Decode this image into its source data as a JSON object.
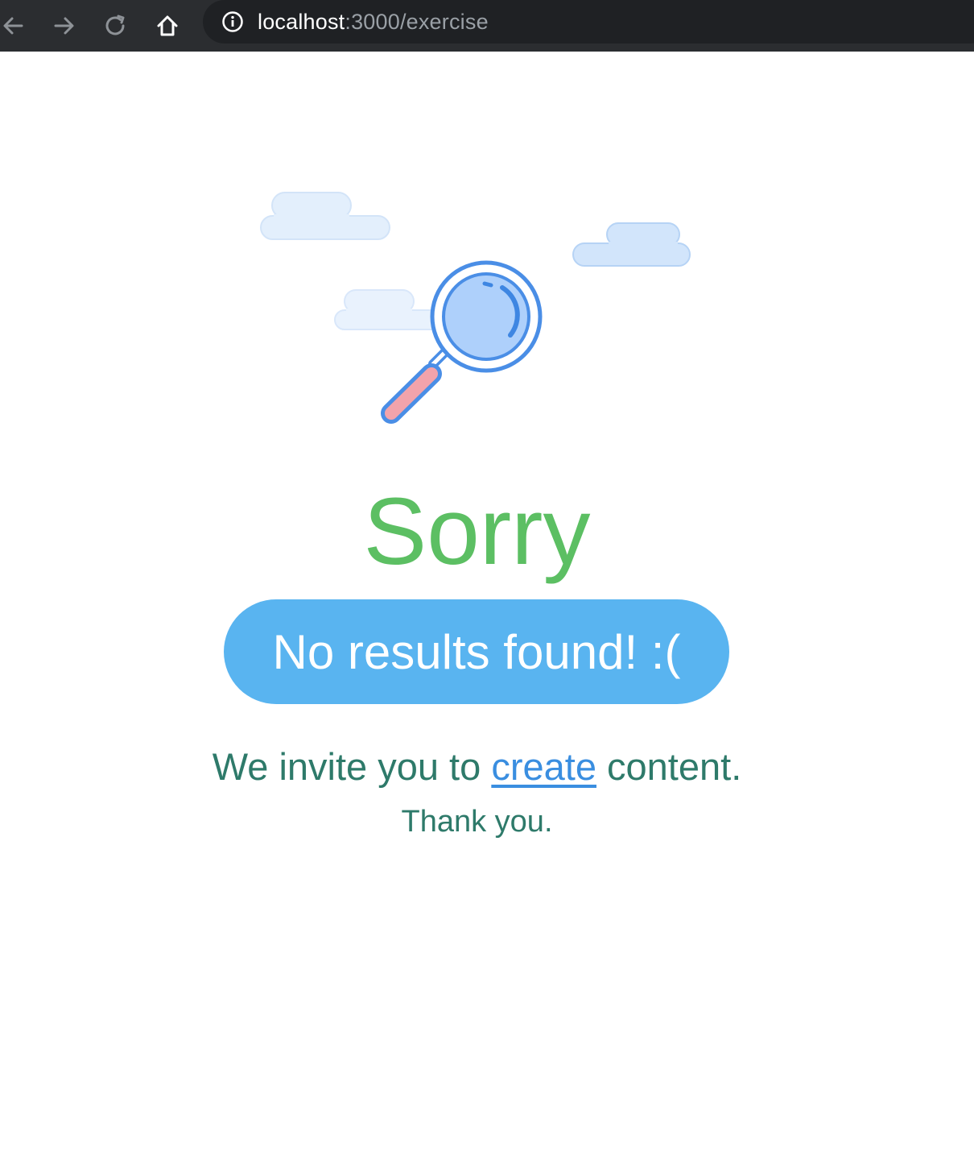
{
  "browser": {
    "url_host": "localhost",
    "url_path": ":3000/exercise",
    "icons": {
      "back": "arrow-left-icon",
      "forward": "arrow-right-icon",
      "reload": "reload-icon",
      "home": "home-icon",
      "site_info": "info-icon"
    }
  },
  "main": {
    "illustration": "magnifying-glass-with-clouds",
    "title": "Sorry",
    "message": "No results found! :(",
    "invite_before": "We invite you to ",
    "invite_link": "create",
    "invite_after": " content.",
    "thanks": "Thank you."
  },
  "colors": {
    "title": "#5cbf63",
    "pill": "#59b4f0",
    "text": "#2e7a6a",
    "link": "#3a8ee0",
    "toolbar": "#2b2d30"
  }
}
